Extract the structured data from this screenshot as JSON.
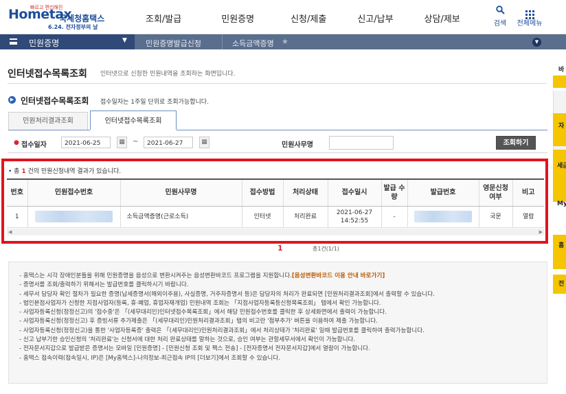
{
  "header": {
    "logo": {
      "brand": "Hometax",
      "agency": "국세청홈택스",
      "tagline": "빠르고 편리해진",
      "date": "6.24. 전자정부의 날"
    },
    "nav": [
      "조회/발급",
      "민원증명",
      "신청/제출",
      "신고/납부",
      "상담/제보"
    ],
    "search_label": "검색",
    "menu_label": "전체메뉴"
  },
  "breadcrumb": {
    "level1": "민원증명",
    "level2": "민원증명발급신청",
    "level3": "소득금액증명"
  },
  "page": {
    "title": "인터넷접수목록조회",
    "description": "인터넷으로 신청한 민원내역을 조회하는 화면입니다."
  },
  "section": {
    "title": "인터넷접수목록조회",
    "description": "접수일자는 1주일 단위로 조회가능합니다."
  },
  "tabs": [
    {
      "label": "민원처리결과조회",
      "active": false
    },
    {
      "label": "인터넷접수목록조회",
      "active": true
    }
  ],
  "search_form": {
    "date_label": "접수일자",
    "date_from": "2021-06-25",
    "date_to": "2021-06-27",
    "tilde": "~",
    "office_label": "민원사무명",
    "office_value": "",
    "button": "조회하기"
  },
  "result": {
    "count_prefix": "• 총",
    "count": "1",
    "count_suffix": "건의 민원신청내역 결과가 있습니다.",
    "columns": [
      "번호",
      "민원접수번호",
      "민원사무명",
      "접수방법",
      "처리상태",
      "접수일시",
      "발급 수량",
      "발급번호",
      "영문신청 여부",
      "비고"
    ],
    "rows": [
      {
        "no": "1",
        "office": "소득금액증명(근로소득)",
        "method": "인터넷",
        "status": "처리완료",
        "date": "2021-06-27",
        "time": "14:52:55",
        "qty": "-",
        "english": "국문",
        "note": "열람"
      }
    ]
  },
  "pager": {
    "current": "1",
    "info": "총1건(1/1)"
  },
  "notice": {
    "items": [
      "- 홈택스는 시각 장애인분들을 위해 민원증명을 음성으로 변환시켜주는 음성변환바코드 프로그램을 지원합니다.",
      "- 증명서를 조회/출력하기 위해서는 발급번호를 클릭하시기 바랍니다.",
      "- 세무서 담당자 확인 절차가 필요한 증명(납세증명서(해외이주용), 사실증명, 거주자증명서 등)은 담당자의 처리가 완료되면 [민원처리결과조회]에서 출력할 수 있습니다.",
      "- 법인본점사업자가 신청한 지점사업자(등록, 휴·폐업, 휴업자재개업) 민원내역 조회는 「지점사업자등록등신청목록조회」 탭에서 확인 가능합니다.",
      "- 사업자등록신청(정정신고)의 '접수중'은 「(세무대리인)인터넷접수목록조회」에서 해당 민원접수번호를 클릭한 후 상세화면에서 출력이 가능합니다.",
      "- 사업자등록신청(정정신고) 후 증빙서류 추가제출은 「(세무대리인)민원처리결과조회」탭의 비고란 '첨부추가' 버튼을 이용하여 제출 가능합니다.",
      "- 사업자등록신청(정정신고)을 통한 '사업자등록증' 출력은 「(세무대리인)민원처리결과조회」에서 처리상태가 '처리완료' 일때 발급번호를 클릭하여 출력가능합니다.",
      "- 신고 납부기한 승인신청의 '처리완료'는 신청서에 대한 처리 완료상태를 말하는 것으로, 승인 여부는 관할세무서에서 확인이 가능합니다.",
      "- 전자문서지갑으로 발급받은 증명서는 모바일 [민원증명] - [민원신청 조회 및 팩스 전송] - [전자증명서 전자문서지갑]에서 열람이 가능합니다.",
      "- 홈택스 접속이력(접속일시, IP)은 [My홈택스]-나의정보-최근접속 IP의 [더보기]에서 조회할 수 있습니다."
    ],
    "link_text": "[음성변환바코드 이용 안내 바로가기]"
  },
  "side_panel": {
    "labels": [
      "바",
      "자",
      "세금",
      "My",
      "홈",
      "전"
    ]
  },
  "colors": {
    "brand": "#1d4e9a",
    "highlight": "#e0131f",
    "breadcrumb_dark": "#2f4a78",
    "breadcrumb": "#5a6e8d",
    "side_yellow": "#f5c500"
  }
}
